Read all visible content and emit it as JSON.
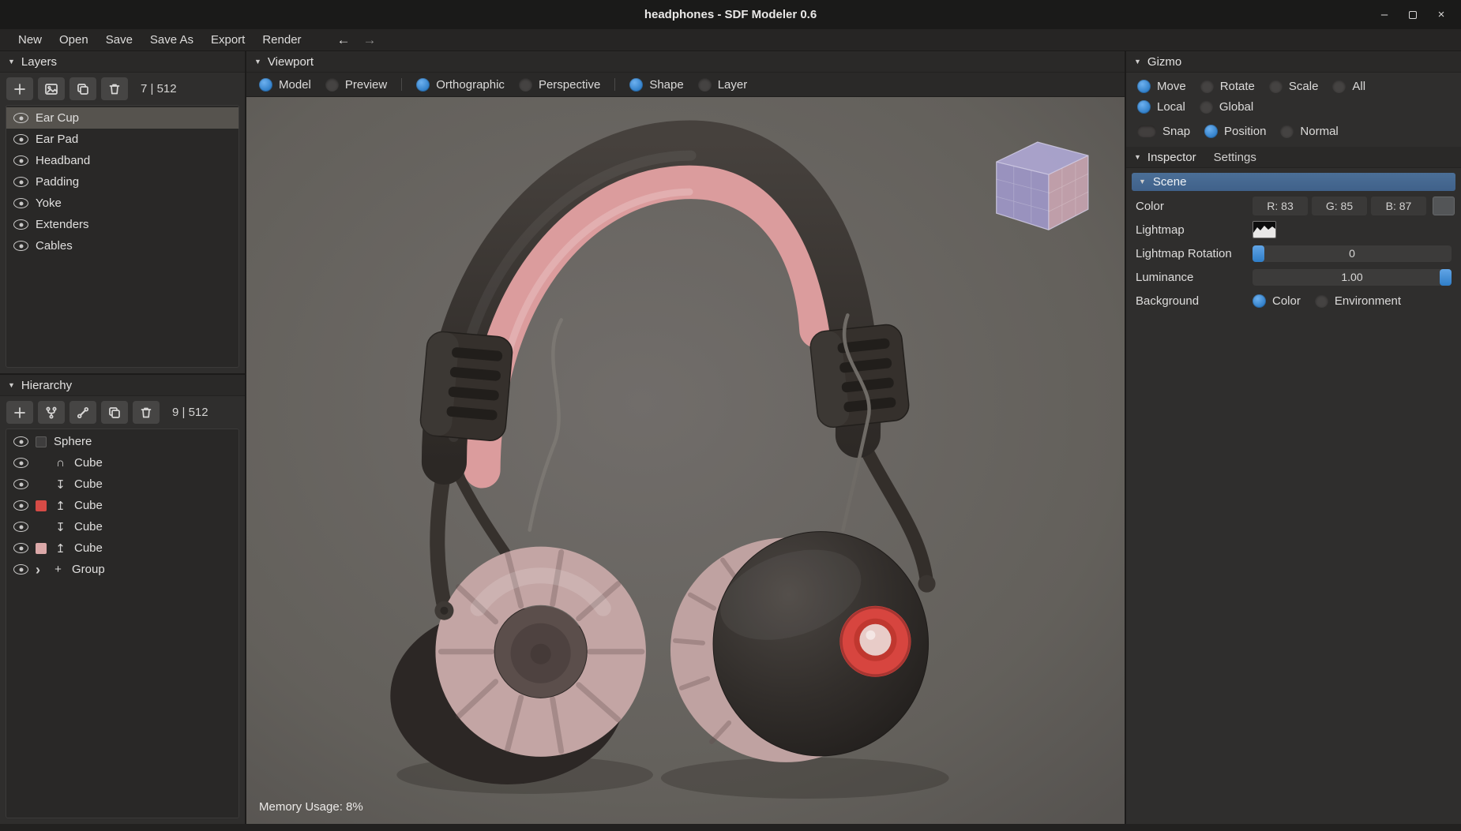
{
  "icons": {
    "collapse": "▼",
    "expander": "›",
    "back": "←",
    "forward": "→",
    "minimize": "–",
    "close": "×"
  },
  "titlebar": {
    "title": "headphones - SDF Modeler 0.6"
  },
  "menubar": {
    "items": [
      "New",
      "Open",
      "Save",
      "Save As",
      "Export",
      "Render"
    ]
  },
  "layers_panel": {
    "header": "Layers",
    "count": "7 | 512",
    "items": [
      {
        "label": "Ear Cup",
        "selected": true
      },
      {
        "label": "Ear Pad",
        "selected": false
      },
      {
        "label": "Headband",
        "selected": false
      },
      {
        "label": "Padding",
        "selected": false
      },
      {
        "label": "Yoke",
        "selected": false
      },
      {
        "label": "Extenders",
        "selected": false
      },
      {
        "label": "Cables",
        "selected": false
      }
    ]
  },
  "hierarchy_panel": {
    "header": "Hierarchy",
    "count": "9 | 512",
    "items": [
      {
        "label": "Sphere",
        "op": "",
        "swatch": "rgba(255,255,255,0.10)"
      },
      {
        "label": "Cube",
        "op": "∩",
        "swatch": ""
      },
      {
        "label": "Cube",
        "op": "↧",
        "swatch": ""
      },
      {
        "label": "Cube",
        "op": "↥",
        "swatch": "#d64b46"
      },
      {
        "label": "Cube",
        "op": "↧",
        "swatch": ""
      },
      {
        "label": "Cube",
        "op": "↥",
        "swatch": "#dba8a8"
      },
      {
        "label": "Group",
        "op": "+",
        "swatch": ""
      }
    ]
  },
  "viewport": {
    "header": "Viewport",
    "toolbar": {
      "mode": [
        {
          "label": "Model",
          "selected": true
        },
        {
          "label": "Preview",
          "selected": false
        }
      ],
      "projection": [
        {
          "label": "Orthographic",
          "selected": true
        },
        {
          "label": "Perspective",
          "selected": false
        }
      ],
      "display": [
        {
          "label": "Shape",
          "selected": true
        },
        {
          "label": "Layer",
          "selected": false
        }
      ]
    },
    "memory_usage": "Memory Usage: 8%"
  },
  "gizmo": {
    "header": "Gizmo",
    "transform_modes": [
      {
        "label": "Move",
        "selected": true
      },
      {
        "label": "Rotate",
        "selected": false
      },
      {
        "label": "Scale",
        "selected": false
      },
      {
        "label": "All",
        "selected": false
      }
    ],
    "space_modes": [
      {
        "label": "Local",
        "selected": true
      },
      {
        "label": "Global",
        "selected": false
      }
    ],
    "snap_label": "Snap",
    "snap_enabled": false,
    "snap_modes": [
      {
        "label": "Position",
        "selected": true
      },
      {
        "label": "Normal",
        "selected": false
      }
    ]
  },
  "inspector": {
    "tabs": [
      {
        "label": "Inspector",
        "active": true
      },
      {
        "label": "Settings",
        "active": false
      }
    ],
    "scene": {
      "header": "Scene",
      "color": {
        "label": "Color",
        "r": "R: 83",
        "g": "G: 85",
        "b": "B: 87",
        "value_hex": "#535557"
      },
      "lightmap": {
        "label": "Lightmap"
      },
      "rotation": {
        "label": "Lightmap Rotation",
        "value": "0"
      },
      "luminance": {
        "label": "Luminance",
        "value": "1.00"
      },
      "background": {
        "label": "Background",
        "options": [
          {
            "label": "Color",
            "selected": true
          },
          {
            "label": "Environment",
            "selected": false
          }
        ]
      }
    }
  },
  "render": {
    "colors": {
      "viewport_bg": "#6a6663",
      "headband": "#393430",
      "headband_pad": "#db9c9d",
      "cushion": "#c3a5a4",
      "shell": "#2f2a28",
      "accent_ring": "#d7453f",
      "ring_button": "#e8ccc8",
      "nav_cube_front": "#9d97c7",
      "nav_cube_side": "#c7a4b0",
      "nav_cube_top": "#aea7d2",
      "accent_blue": "#3f8edc"
    }
  }
}
